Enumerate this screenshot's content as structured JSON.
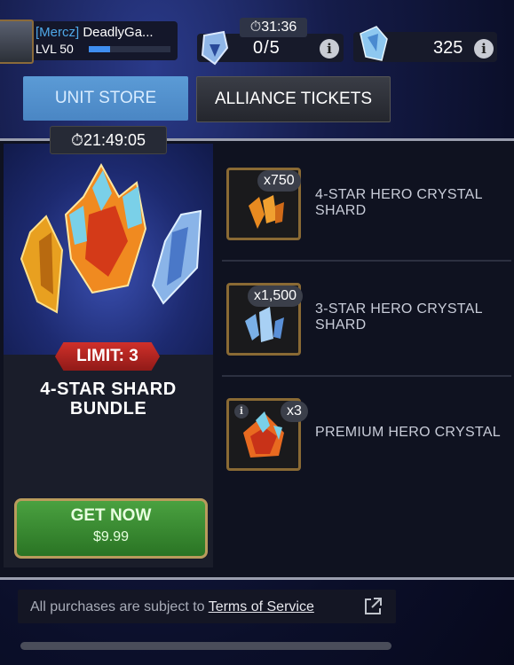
{
  "profile": {
    "tag": "[Mercz]",
    "name": "DeadlyGa...",
    "level": "LVL 50",
    "xp_fraction": 0.26
  },
  "tickets": {
    "timer": "31:36",
    "value": "0/5"
  },
  "shards": {
    "value": "325"
  },
  "tabs": [
    {
      "label": "UNIT STORE"
    },
    {
      "label": "ALLIANCE TICKETS"
    }
  ],
  "offer": {
    "timer": "21:49:05",
    "limit": "LIMIT: 3",
    "title_line1": "4-STAR SHARD",
    "title_line2": "BUNDLE",
    "button_label": "GET NOW",
    "price": "$9.99"
  },
  "items": [
    {
      "qty": "x750",
      "name_line1": "4-STAR HERO CRYSTAL",
      "name_line2": "SHARD"
    },
    {
      "qty": "x1,500",
      "name_line1": "3-STAR HERO CRYSTAL",
      "name_line2": "SHARD"
    },
    {
      "qty": "x3",
      "name_line1": "PREMIUM HERO CRYSTAL",
      "name_line2": ""
    }
  ],
  "footer": {
    "text": "All purchases are subject to ",
    "link": "Terms of Service"
  },
  "icons": {
    "info": "i",
    "timer": "stopwatch-icon",
    "external": "external-link-icon"
  },
  "colors": {
    "accent_blue": "#4a86c4",
    "buy_green": "#2a7424",
    "limit_red": "#c0281f"
  }
}
